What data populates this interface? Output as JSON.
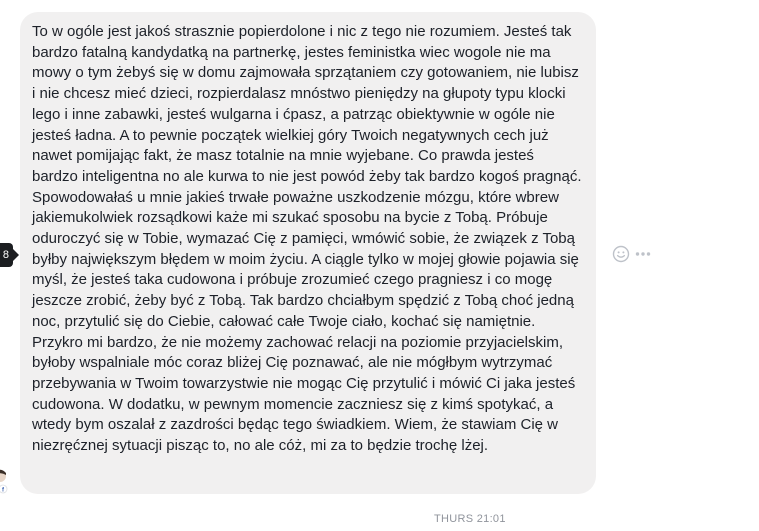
{
  "message": {
    "text": "To w ogóle jest jakoś strasznie popierdolone i nic z tego nie rozumiem. Jesteś tak bardzo fatalną kandydatką na partnerkę, jestes feministka wiec wogole nie ma mowy o tym żebyś się w domu zajmowała sprzątaniem czy gotowaniem, nie lubisz i nie chcesz mieć dzieci, rozpierdalasz mnóstwo pieniędzy na głupoty typu klocki lego i inne zabawki, jesteś wulgarna i ćpasz, a patrząc obiektywnie w ogóle nie jesteś ładna. A to pewnie początek wielkiej góry Twoich negatywnych cech już nawet pomijając fakt, że masz totalnie na mnie wyjebane. Co prawda jesteś bardzo inteligentna no ale kurwa to nie jest powód żeby tak bardzo kogoś pragnąć. Spowodowałaś u mnie jakieś trwałe poważne uszkodzenie mózgu, które wbrew jakiemukolwiek rozsądkowi każe mi szukać sposobu na bycie z Tobą. Próbuje oduroczyć się w Tobie, wymazać Cię z pamięci, wmówić sobie, że związek z Tobą byłby największym błędem w moim życiu. A ciągle tylko w mojej głowie pojawia się myśl, że jesteś taka cudowona i próbuje zrozumieć czego pragniesz i co mogę jeszcze zrobić, żeby być z Tobą. Tak bardzo chciałbym spędzić z Tobą choć jedną noc, przytulić się do Ciebie, całować całe Twoje ciało, kochać się namiętnie. Przykro mi bardzo, że nie możemy zachować relacji na poziomie przyjacielskim, byłoby wspalniale móc coraz bliżej Cię poznawać, ale nie mógłbym wytrzymać przebywania w Twoim towarzystwie nie mogąc Cię przytulić i mówić Ci jaka jesteś cudowona. W dodatku, w pewnym momencie zaczniesz się z kimś spotykać, a wtedy bym oszalał z zazdrości będąc tego świadkiem. Wiem, że stawiam Cię w niezręćznej sytuacji pisząc to, no ale cóż, mi za to będzie trochę lżej."
  },
  "tooltip": {
    "label": "8"
  },
  "actions": {
    "react_icon": "smiley-icon",
    "more_icon": "ellipsis-icon"
  },
  "timestamp": "THURS 21:01",
  "colors": {
    "bubble_bg": "#f1f0f0",
    "text": "#1d2129",
    "meta": "#90949c",
    "tooltip_bg": "#1c1e21"
  }
}
